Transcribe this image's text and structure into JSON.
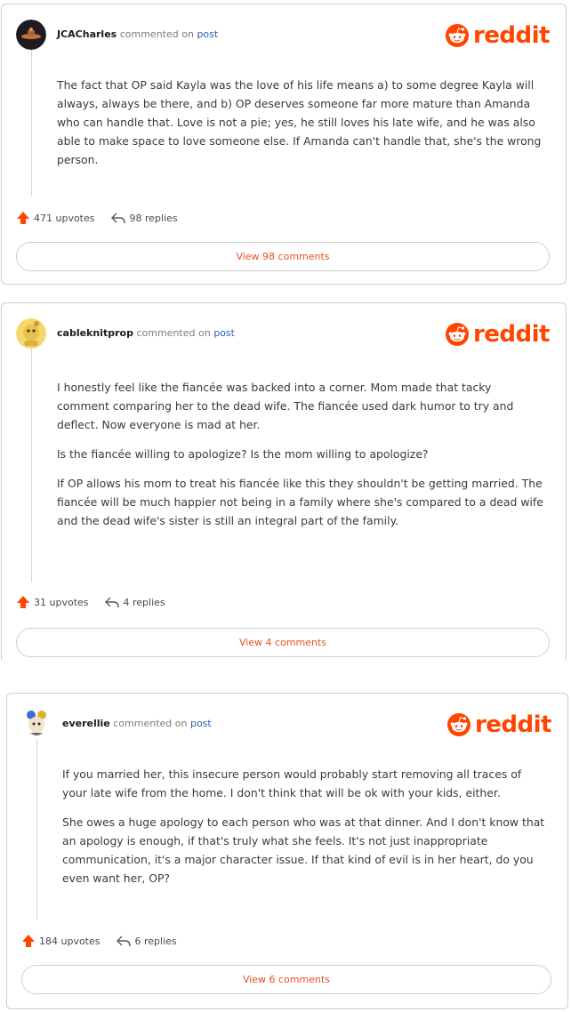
{
  "brand": {
    "name": "reddit",
    "color": "#ff4500"
  },
  "comments": [
    {
      "username": "JCACharles",
      "commented_on": "commented on",
      "post_link": "post",
      "paragraphs": [
        "The fact that OP said Kayla was the love of his life means a) to some degree Kayla will always, always be there, and b) OP deserves someone far more mature than Amanda who can handle that. Love is not a pie; yes, he still loves his late wife, and he was also able to make space to love someone else. If Amanda can't handle that, she's the wrong person."
      ],
      "upvotes": "471 upvotes",
      "replies": "98 replies",
      "view_label": "View 98 comments"
    },
    {
      "username": "cableknitprop",
      "commented_on": "commented on",
      "post_link": "post",
      "paragraphs": [
        "I honestly feel like the fiancée was backed into a corner. Mom made that tacky comment comparing her to the dead wife. The fiancée used dark humor to try and deflect. Now everyone is mad at her.",
        "Is the fiancée willing to apologize? Is the mom willing to apologize?",
        "If OP allows his mom to treat his fiancée like this they shouldn't be getting married. The fiancée will be much happier not being in a family where she's compared to a dead wife and the dead wife's sister is still an integral part of the family."
      ],
      "upvotes": "31 upvotes",
      "replies": "4 replies",
      "view_label": "View 4 comments"
    },
    {
      "username": "everellie",
      "commented_on": "commented on",
      "post_link": "post",
      "paragraphs": [
        "If you married her, this insecure person would probably start removing all traces of your late wife from the home. I don't think that will be ok with your kids, either.",
        "She owes a huge apology to each person who was at that dinner. And I don't know that an apology is enough, if that's truly what she feels. It's not just inappropriate communication, it's a major character issue. If that kind of evil is in her heart, do you even want her, OP?"
      ],
      "upvotes": "184 upvotes",
      "replies": "6 replies",
      "view_label": "View 6 comments"
    }
  ]
}
